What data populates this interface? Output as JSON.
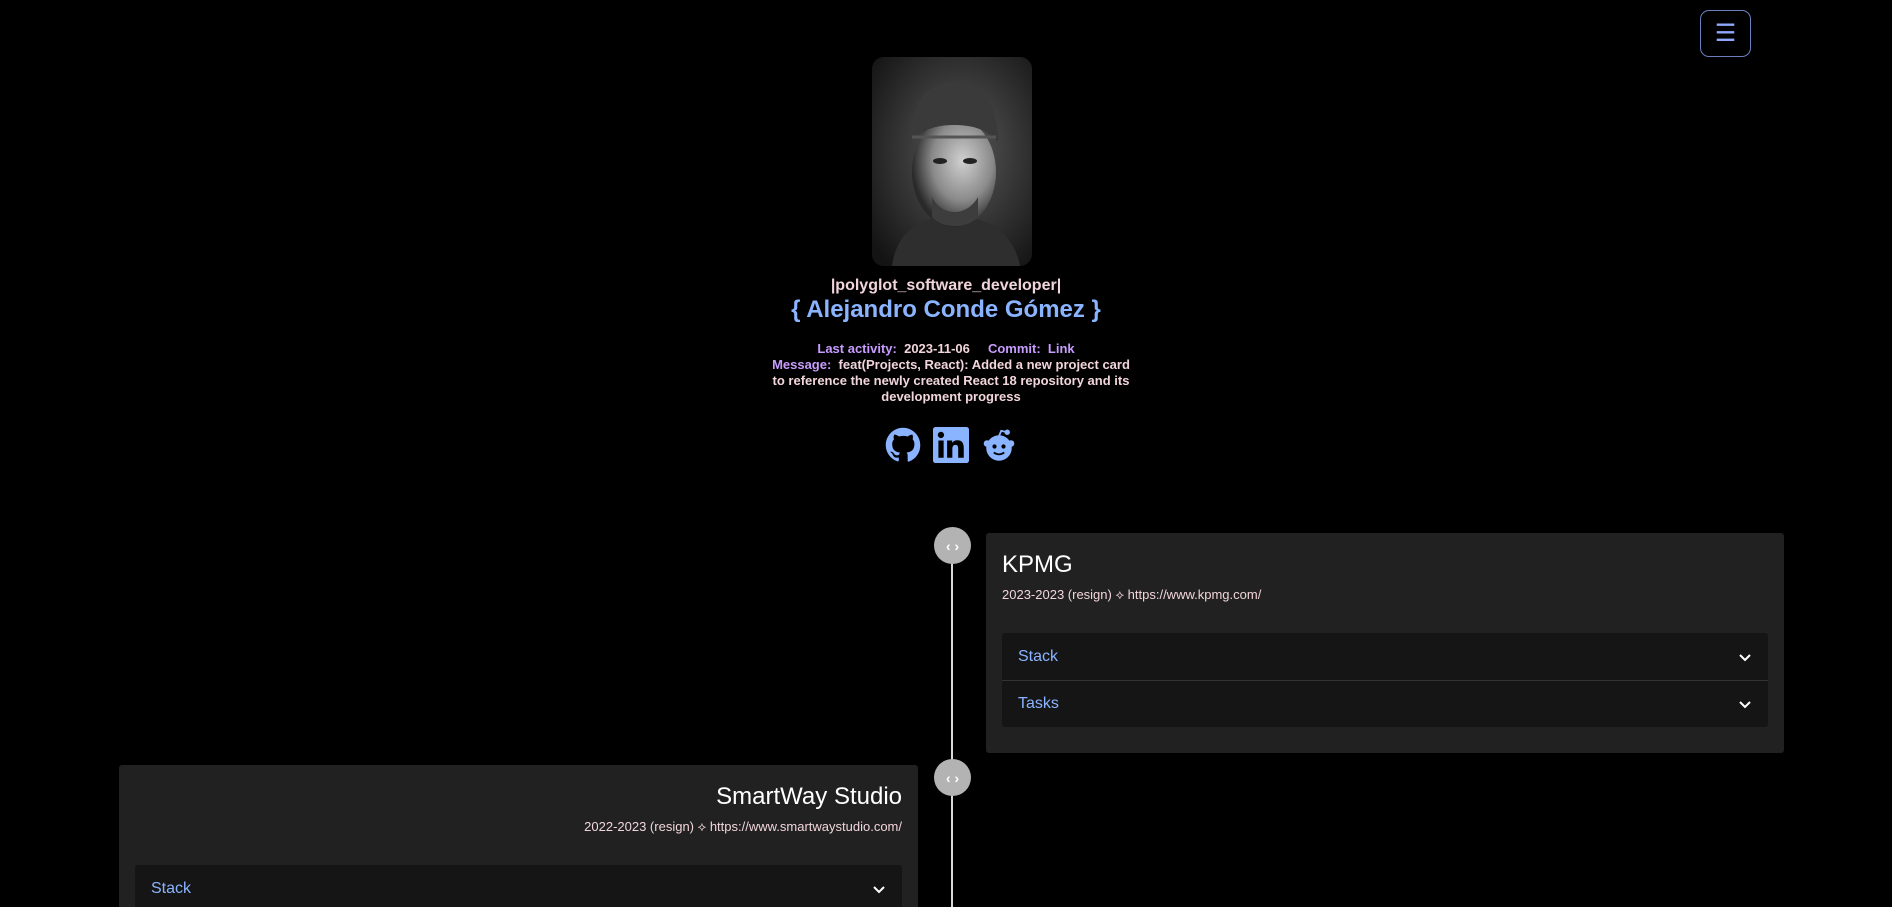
{
  "header": {
    "menu_icon": "☰",
    "role": "|polyglot_software_developer|",
    "name": "{ Alejandro Conde Gómez }",
    "activity": {
      "last_activity_label": "Last activity:",
      "last_activity_value": "2023-11-06",
      "commit_label": "Commit:",
      "commit_link": "Link",
      "message_label": "Message:",
      "message_value": "feat(Projects, React): Added a new project card to reference the newly created React 18 repository and its development progress"
    },
    "socials": [
      "github-icon",
      "linkedin-icon",
      "reddit-icon"
    ]
  },
  "colors": {
    "accent": "#8ab4ff",
    "label_purple": "#c89cff",
    "text_pink": "#f1d5dc",
    "card_bg": "#212121"
  },
  "timeline": {
    "dot_symbol": "‹ ›",
    "entries": [
      {
        "company": "KPMG",
        "period": "2023-2023 (resign) ⟡ https://www.kpmg.com/",
        "sections": [
          "Stack",
          "Tasks"
        ]
      },
      {
        "company": "SmartWay Studio",
        "period": "2022-2023 (resign) ⟡ https://www.smartwaystudio.com/",
        "sections": [
          "Stack"
        ]
      }
    ]
  }
}
